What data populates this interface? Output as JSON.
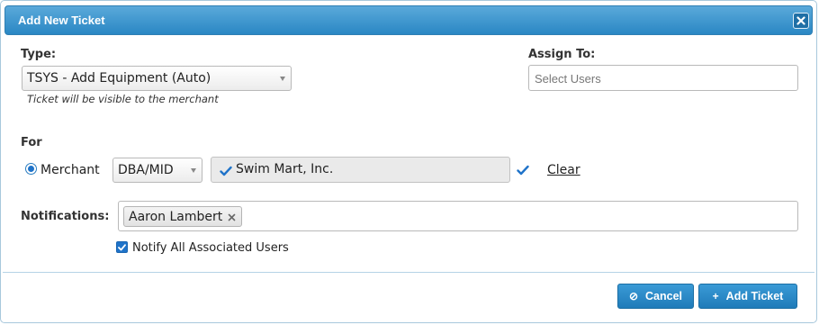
{
  "dialog": {
    "title": "Add New Ticket",
    "close_icon": "close-icon"
  },
  "type": {
    "label": "Type:",
    "selected": "TSYS - Add Equipment (Auto)",
    "hint": "Ticket will be visible to the merchant"
  },
  "assign": {
    "label": "Assign To:",
    "placeholder": "Select Users"
  },
  "for": {
    "label": "For",
    "radio_label": "Merchant",
    "lookup_selected": "DBA/MID",
    "merchant_value": "Swim Mart, Inc.",
    "clear_label": "Clear",
    "check_icon": "checkmark-icon"
  },
  "notifications": {
    "label": "Notifications:",
    "tags": [
      "Aaron Lambert"
    ],
    "notify_all_label": "Notify All Associated Users",
    "notify_all_checked": true
  },
  "footer": {
    "cancel_label": "Cancel",
    "add_label": "Add Ticket",
    "cancel_icon": "ban-icon",
    "add_icon": "plus-icon"
  },
  "colors": {
    "accent": "#2a87c4",
    "link": "#1f73c9"
  }
}
